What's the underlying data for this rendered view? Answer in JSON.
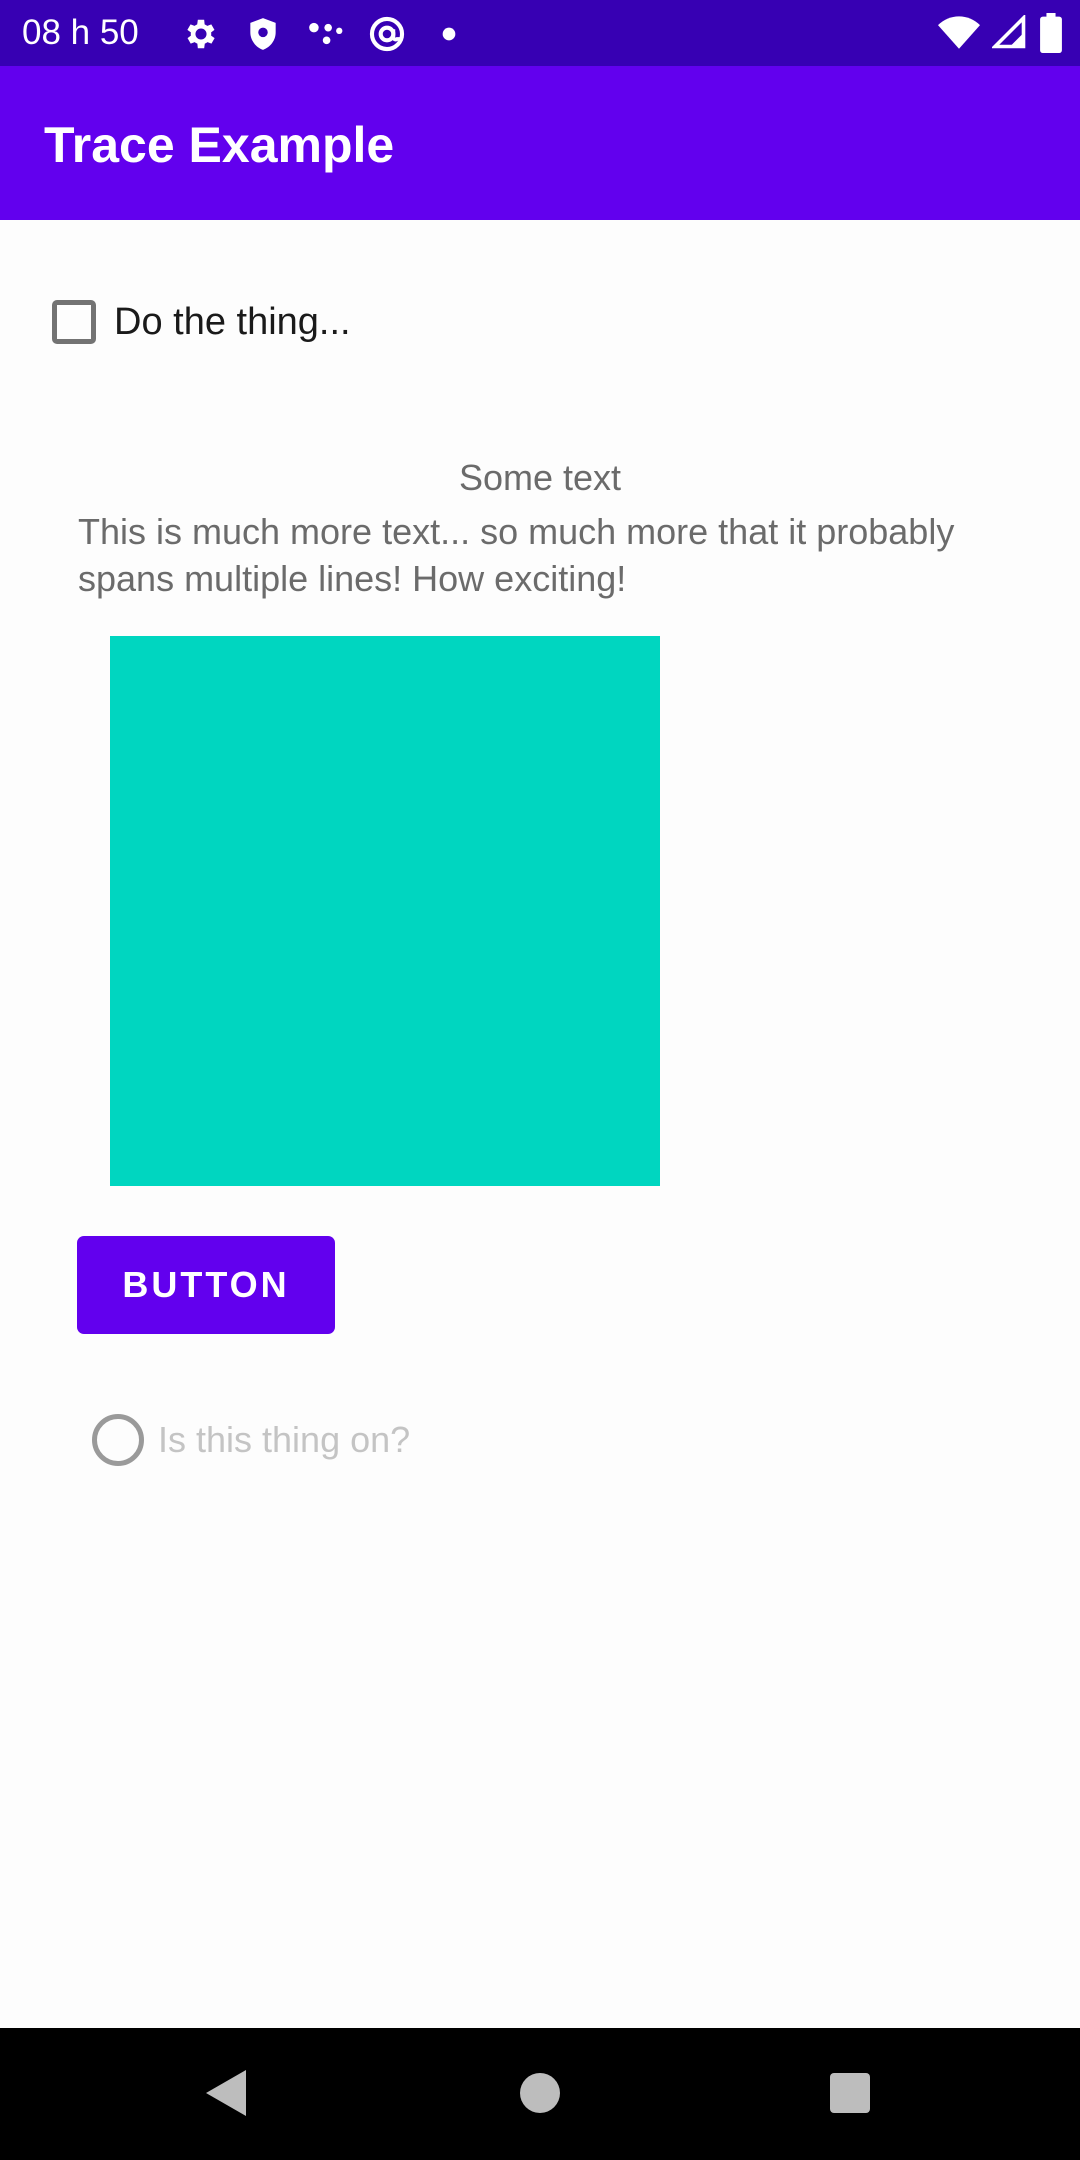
{
  "status_bar": {
    "time": "08 h 50",
    "icons_left": [
      "settings-icon",
      "shield-icon",
      "apps-icon",
      "at-icon",
      "dot-icon"
    ],
    "icons_right": [
      "wifi-icon",
      "signal-icon",
      "battery-icon"
    ]
  },
  "app_bar": {
    "title": "Trace Example"
  },
  "content": {
    "checkbox_label": "Do the thing...",
    "checkbox_checked": false,
    "some_text": "Some text",
    "more_text": "This is much more text... so much more that it probably spans multiple lines! How exciting!",
    "button_label": "BUTTON",
    "radio_label": "Is this thing on?",
    "radio_checked": false
  },
  "colors": {
    "status_bar": "#3700b3",
    "app_bar": "#6200ee",
    "accent_square": "#00d6c0",
    "button": "#6200ee"
  },
  "nav_bar": {
    "icons": [
      "back-icon",
      "home-icon",
      "recents-icon"
    ]
  }
}
